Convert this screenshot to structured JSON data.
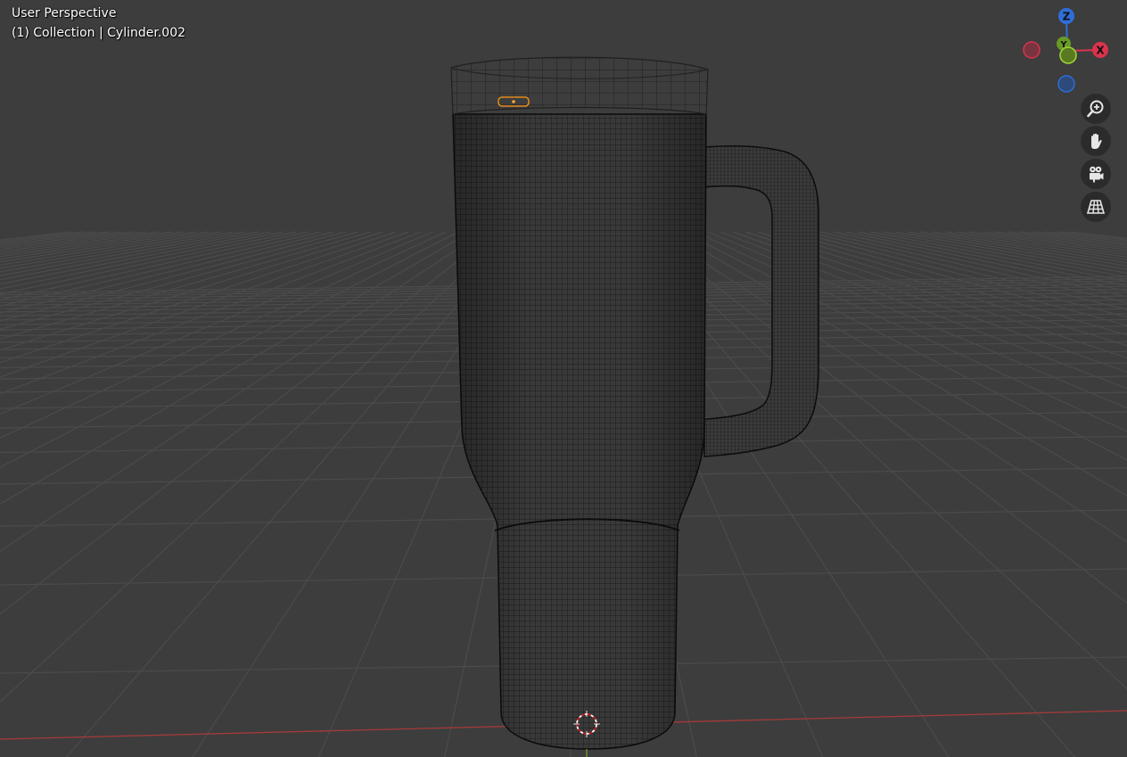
{
  "viewport": {
    "view_name": "User Perspective",
    "object_info": "(1) Collection | Cylinder.002"
  },
  "gizmo": {
    "axes": [
      {
        "label": "Z",
        "color": "#2f6ed8"
      },
      {
        "label": "X",
        "color": "#d9344c"
      },
      {
        "label": "Y",
        "color": "#7fb62b"
      }
    ]
  },
  "nav_buttons": [
    {
      "icon": "zoom-icon"
    },
    {
      "icon": "hand-pan-icon"
    },
    {
      "icon": "camera-icon"
    },
    {
      "icon": "grid-perspective-icon"
    }
  ],
  "colors": {
    "background": "#3d3d3d",
    "grid": "#4a4a4a",
    "x_axis_line": "#b03a3a",
    "wire": "#111111",
    "selection": "#e08a1e"
  }
}
